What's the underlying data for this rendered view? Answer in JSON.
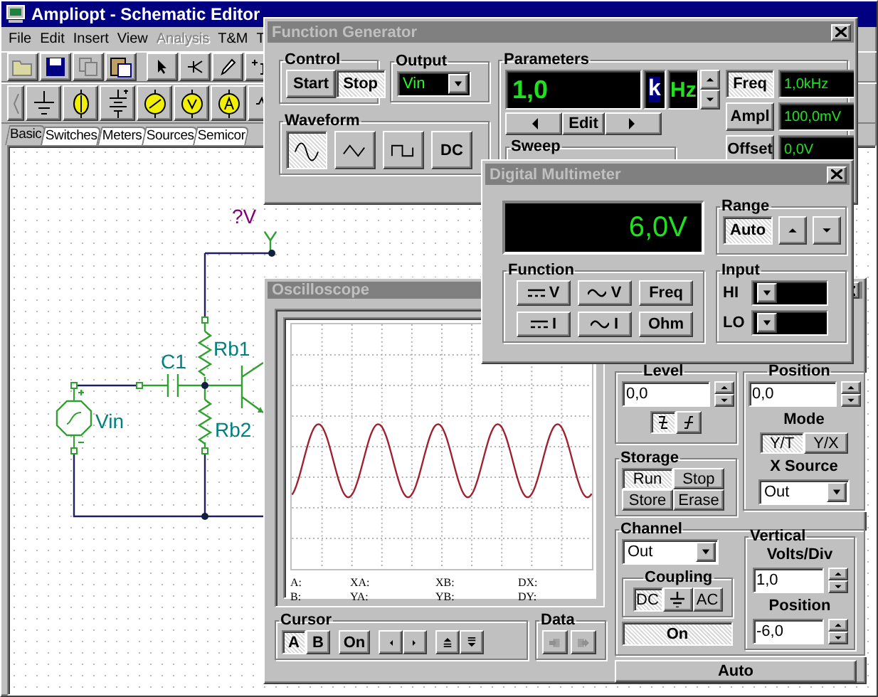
{
  "main_window": {
    "title": "Ampliopt - Schematic Editor",
    "menu": [
      {
        "label": "File",
        "disabled": false
      },
      {
        "label": "Edit",
        "disabled": false
      },
      {
        "label": "Insert",
        "disabled": false
      },
      {
        "label": "View",
        "disabled": false
      },
      {
        "label": "Analysis",
        "disabled": true
      },
      {
        "label": "T&M",
        "disabled": false
      },
      {
        "label": "T",
        "disabled": false
      }
    ],
    "component_tabs": [
      {
        "label": "Basic",
        "selected": true
      },
      {
        "label": "Switches",
        "selected": false
      },
      {
        "label": "Meters",
        "selected": false
      },
      {
        "label": "Sources",
        "selected": false
      },
      {
        "label": "Semicor",
        "selected": false
      }
    ],
    "schematic": {
      "probe_label": "?V",
      "capacitor_label": "C1",
      "resistor_labels": [
        "Rb1",
        "Rb2"
      ],
      "source_label": "Vin"
    }
  },
  "function_generator": {
    "title": "Function Generator",
    "control": {
      "title": "Control",
      "buttons": [
        {
          "label": "Start",
          "selected": false
        },
        {
          "label": "Stop",
          "selected": true
        }
      ]
    },
    "output": {
      "title": "Output",
      "value": "Vin"
    },
    "waveform": {
      "title": "Waveform",
      "buttons": [
        {
          "kind": "sine",
          "selected": true
        },
        {
          "kind": "triangle",
          "selected": false
        },
        {
          "kind": "square",
          "selected": false
        },
        {
          "kind": "text",
          "label": "DC",
          "selected": false
        }
      ]
    },
    "parameters": {
      "title": "Parameters",
      "display_value": "1,0",
      "prefix": "k",
      "unit": "Hz",
      "edit_label": "Edit",
      "sweep_title": "Sweep",
      "rows": [
        {
          "label": "Freq",
          "value": "1,0kHz",
          "selected": true
        },
        {
          "label": "Ampl",
          "value": "100,0mV",
          "selected": false
        },
        {
          "label": "Offset",
          "value": "0,0V",
          "selected": false
        }
      ]
    }
  },
  "multimeter": {
    "title": "Digital Multimeter",
    "reading": "6,0V",
    "range": {
      "title": "Range",
      "auto_label": "Auto",
      "auto_on": true
    },
    "function": {
      "title": "Function",
      "buttons": [
        {
          "kind": "dc",
          "label": "V"
        },
        {
          "kind": "ac",
          "label": "V"
        },
        {
          "kind": "text",
          "label": "Freq"
        },
        {
          "kind": "dc",
          "label": "I"
        },
        {
          "kind": "ac",
          "label": "I"
        },
        {
          "kind": "text",
          "label": "Ohm"
        }
      ]
    },
    "input": {
      "title": "Input",
      "rows": [
        {
          "label": "HI"
        },
        {
          "label": "LO"
        }
      ]
    }
  },
  "oscilloscope": {
    "title": "Oscilloscope",
    "readouts": [
      [
        "A:",
        "XA:",
        "XB:",
        "DX:"
      ],
      [
        "B:",
        "YA:",
        "YB:",
        "DY:"
      ]
    ],
    "cursor": {
      "title": "Cursor",
      "buttons": [
        {
          "label": "A",
          "selected": true
        },
        {
          "label": "B",
          "selected": false
        }
      ],
      "on_label": "On"
    },
    "data": {
      "title": "Data"
    },
    "level": {
      "title": "Level",
      "value": "0,0",
      "slopes": [
        {
          "kind": "falling",
          "selected": true
        },
        {
          "kind": "rising",
          "selected": false
        }
      ]
    },
    "storage": {
      "title": "Storage",
      "buttons": [
        {
          "label": "Run",
          "selected": true
        },
        {
          "label": "Stop",
          "selected": false
        },
        {
          "label": "Store",
          "selected": false
        },
        {
          "label": "Erase",
          "selected": false
        }
      ]
    },
    "position": {
      "title": "Position",
      "value": "0,0"
    },
    "mode": {
      "title": "Mode",
      "options": [
        {
          "label": "Y/T",
          "selected": true
        },
        {
          "label": "Y/X",
          "selected": false
        }
      ]
    },
    "x_source": {
      "title": "X Source",
      "value": "Out"
    },
    "channel": {
      "title": "Channel",
      "value": "Out",
      "on_label": "On",
      "on": true,
      "coupling": {
        "title": "Coupling",
        "options": [
          {
            "kind": "text",
            "label": "DC",
            "selected": true
          },
          {
            "kind": "ground",
            "selected": false
          },
          {
            "kind": "text",
            "label": "AC",
            "selected": false
          }
        ]
      }
    },
    "vertical": {
      "title": "Vertical",
      "volts_title": "Volts/Div",
      "volts_value": "1,0",
      "position_title": "Position",
      "position_value": "-6,0"
    },
    "auto_label": "Auto"
  }
}
